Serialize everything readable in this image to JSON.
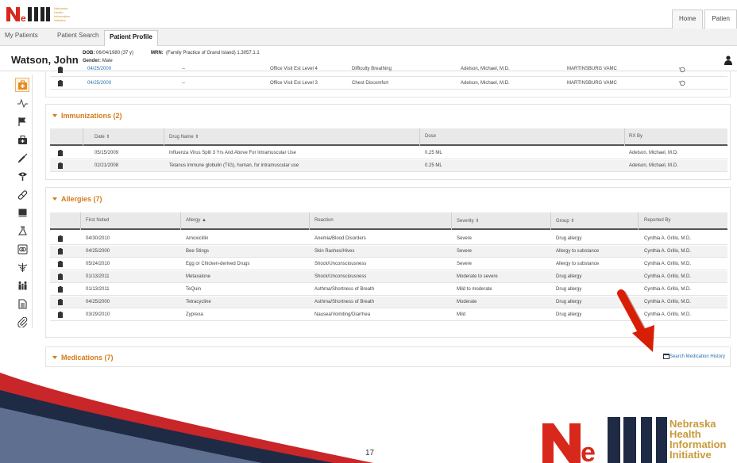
{
  "header": {
    "logo_letters": "NeHII",
    "logo_tagline": [
      "Nebraska",
      "Health",
      "Information",
      "Initiative"
    ],
    "top_tabs": [
      "Home",
      "Patien"
    ]
  },
  "subtabs": [
    "My Patients",
    "Patient Search",
    "Patient Profile"
  ],
  "patient": {
    "name": "Watson, John",
    "dob_label": "DOB:",
    "dob_value": "06/04/1980 (37 y)",
    "gender_label": "Gender:",
    "gender_value": "Male",
    "mrn_label": "MRN:",
    "mrn_value": "(Family Practice of Grand Island) 1.3057.1.1"
  },
  "rail_icons": [
    "medical-bag-icon",
    "vitals-icon",
    "flag-icon",
    "kit-icon",
    "syringe-icon",
    "eye-exam-icon",
    "pill-icon",
    "book-icon",
    "flask-icon",
    "scan-icon",
    "caduceus-icon",
    "family-icon",
    "document-icon",
    "paperclip-icon"
  ],
  "encounters": {
    "rows": [
      {
        "date": "04/25/2000",
        "dash": "--",
        "type": "Office Visit Est Level 4",
        "reason": "Difficulty Breathing",
        "provider": "Adelson, Michael, M.D.",
        "facility": "MARTINSBURG VAMC"
      },
      {
        "date": "04/25/2000",
        "dash": "--",
        "type": "Office Visit Est Level 3",
        "reason": "Chest Discomfort",
        "provider": "Adelson, Michael, M.D.",
        "facility": "MARTINSBURG VAMC"
      }
    ]
  },
  "immunizations": {
    "title": "Immunizations (2)",
    "headers": [
      "Date ⇕",
      "Drug Name ⇕",
      "Dose",
      "RX By"
    ],
    "rows": [
      {
        "date": "05/15/2009",
        "drug": "Influenza Virus Split 3 Yrs And Above For Intramuscular Use",
        "dose": "0.25 ML",
        "rx_by": "Adelson, Michael, M.D."
      },
      {
        "date": "02/21/2008",
        "drug": "Tetanus immune globulin (TIG), human, for intramuscular use",
        "dose": "0.25 ML",
        "rx_by": "Adelson, Michael, M.D."
      }
    ]
  },
  "allergies": {
    "title": "Allergies (7)",
    "headers": [
      "First Noted",
      "Allergy ▲",
      "Reaction",
      "Severity ⇕",
      "Group ⇕",
      "Reported By"
    ],
    "rows": [
      {
        "noted": "04/30/2010",
        "allergy": "Amoxicillin",
        "reaction": "Anemia/Blood Disorders",
        "severity": "Severe",
        "group": "Drug allergy",
        "reported": "Cynthia A. Grillo, M.D."
      },
      {
        "noted": "04/25/2000",
        "allergy": "Bee Stings",
        "reaction": "Skin Rashes/Hives",
        "severity": "Severe",
        "group": "Allergy to substance",
        "reported": "Cynthia A. Grillo, M.D."
      },
      {
        "noted": "05/24/2010",
        "allergy": "Egg or Chicken-derived Drugs",
        "reaction": "Shock/Unconsciousness",
        "severity": "Severe",
        "group": "Allergy to substance",
        "reported": "Cynthia A. Grillo, M.D."
      },
      {
        "noted": "01/13/2011",
        "allergy": "Metaxalone",
        "reaction": "Shock/Unconsciousness",
        "severity": "Moderate to severe",
        "group": "Drug allergy",
        "reported": "Cynthia A. Grillo, M.D."
      },
      {
        "noted": "01/13/2011",
        "allergy": "TeQuin",
        "reaction": "Asthma/Shortness of Breath",
        "severity": "Mild to moderate",
        "group": "Drug allergy",
        "reported": "Cynthia A. Grillo, M.D."
      },
      {
        "noted": "04/25/2000",
        "allergy": "Tetracycline",
        "reaction": "Asthma/Shortness of Breath",
        "severity": "Moderate",
        "group": "Drug allergy",
        "reported": "Cynthia A. Grillo, M.D."
      },
      {
        "noted": "03/29/2010",
        "allergy": "Zyprexa",
        "reaction": "Nausea/Vomiting/Diarrhea",
        "severity": "Mild",
        "group": "Drug allergy",
        "reported": "Cynthia A. Grillo, M.D."
      }
    ]
  },
  "medications": {
    "title": "Medications (7)",
    "search_link": "Search Medication History"
  },
  "footer": {
    "page_number": "17",
    "logo_words": [
      "Nebraska",
      "Health",
      "Information",
      "Initiative"
    ]
  },
  "colors": {
    "accent": "#d57b18",
    "link": "#2a6fb0",
    "arrow": "#d81e05",
    "logo_gold": "#c89a3a",
    "logo_red": "#d8281b"
  }
}
